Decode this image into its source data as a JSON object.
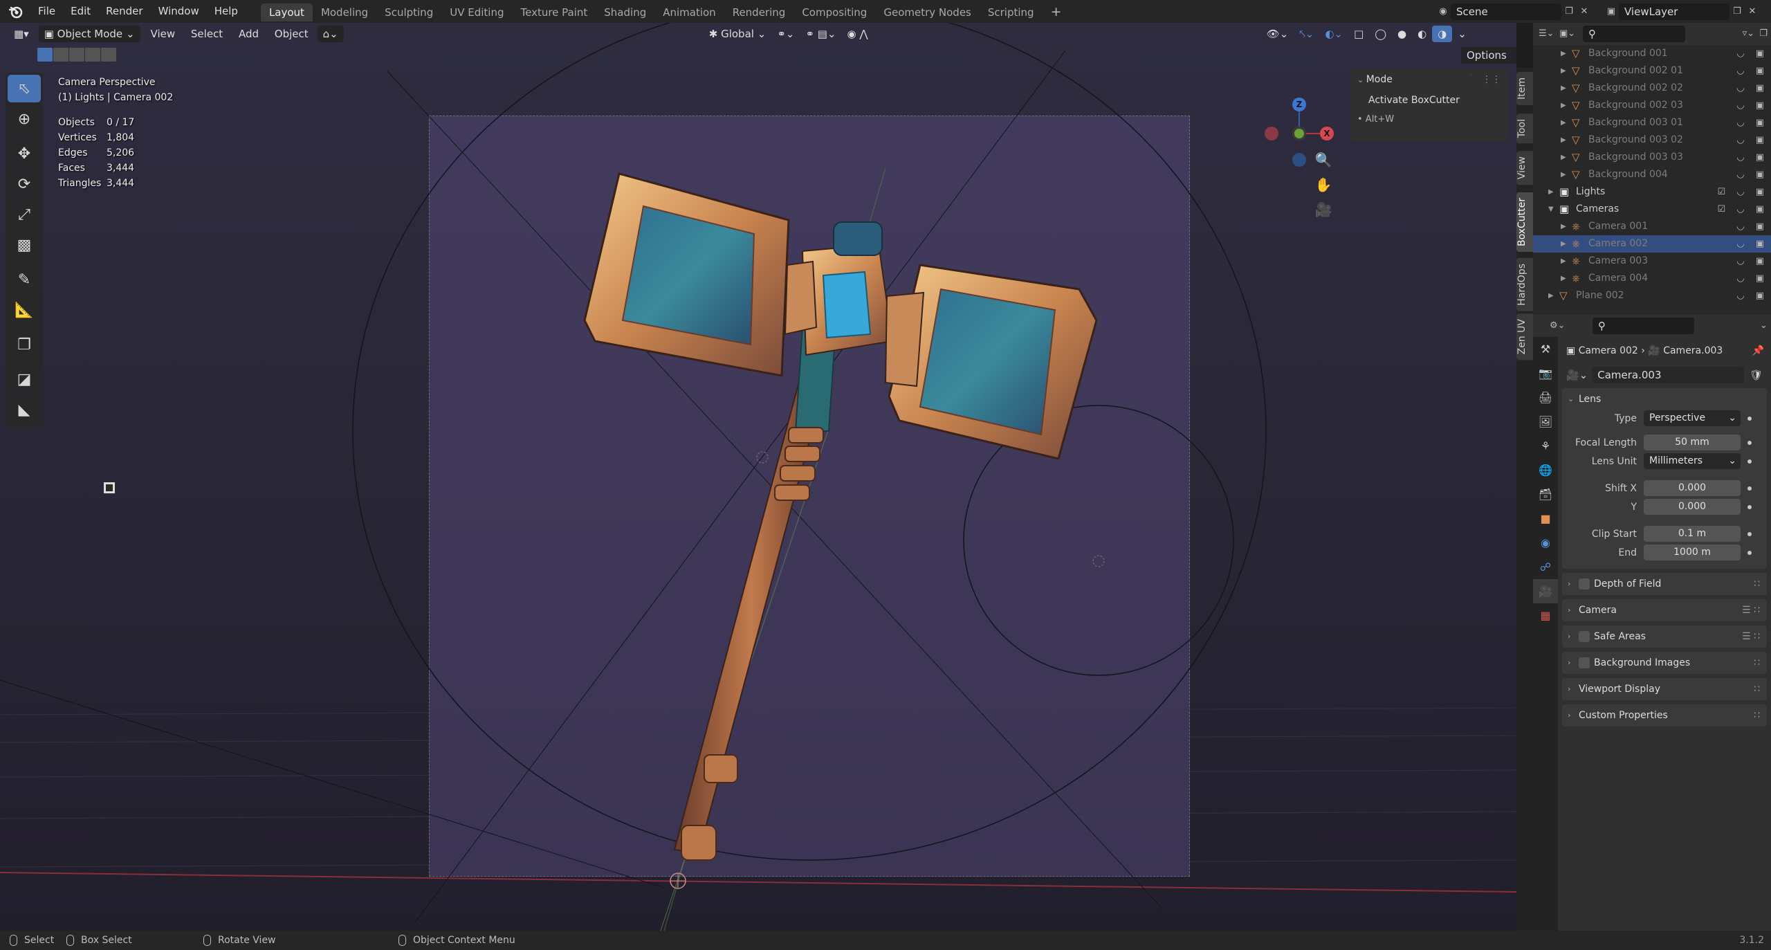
{
  "topbar": {
    "menu": [
      "File",
      "Edit",
      "Render",
      "Window",
      "Help"
    ],
    "workspaces": [
      "Layout",
      "Modeling",
      "Sculpting",
      "UV Editing",
      "Texture Paint",
      "Shading",
      "Animation",
      "Rendering",
      "Compositing",
      "Geometry Nodes",
      "Scripting"
    ],
    "active_workspace": "Layout",
    "add_tab": "+",
    "scene_name": "Scene",
    "view_layer_name": "ViewLayer"
  },
  "viewport_header": {
    "mode": "Object Mode",
    "menus": [
      "View",
      "Select",
      "Add",
      "Object"
    ],
    "transform_orientation": "Global",
    "options_label": "Options"
  },
  "viewport_overlay": {
    "view_name": "Camera Perspective",
    "collection_object": "(1) Lights | Camera 002",
    "stats": [
      {
        "label": "Objects",
        "value": "0 / 17"
      },
      {
        "label": "Vertices",
        "value": "1,804"
      },
      {
        "label": "Edges",
        "value": "5,206"
      },
      {
        "label": "Faces",
        "value": "3,444"
      },
      {
        "label": "Triangles",
        "value": "3,444"
      }
    ]
  },
  "mode_panel": {
    "title": "Mode",
    "button": "Activate BoxCutter",
    "hint": "• Alt+W"
  },
  "gizmo": {
    "x": "X",
    "y": "Y",
    "z": "Z"
  },
  "side_tabs": [
    "Item",
    "Tool",
    "View",
    "BoxCutter",
    "HardOps",
    "Zen UV"
  ],
  "outliner": {
    "rows": [
      {
        "name": "Background 001",
        "indent": 2,
        "type": "mesh",
        "dim": true
      },
      {
        "name": "Background 002 01",
        "indent": 2,
        "type": "mesh",
        "dim": true
      },
      {
        "name": "Background 002 02",
        "indent": 2,
        "type": "mesh",
        "dim": true
      },
      {
        "name": "Background 002 03",
        "indent": 2,
        "type": "mesh",
        "dim": true
      },
      {
        "name": "Background 003 01",
        "indent": 2,
        "type": "mesh",
        "dim": true
      },
      {
        "name": "Background 003 02",
        "indent": 2,
        "type": "mesh",
        "dim": true
      },
      {
        "name": "Background 003 03",
        "indent": 2,
        "type": "mesh",
        "dim": true
      },
      {
        "name": "Background 004",
        "indent": 2,
        "type": "mesh",
        "dim": true
      },
      {
        "name": "Lights",
        "indent": 1,
        "type": "collection",
        "dim": false
      },
      {
        "name": "Cameras",
        "indent": 1,
        "type": "collection",
        "dim": false
      },
      {
        "name": "Camera 001",
        "indent": 2,
        "type": "camera",
        "dim": true
      },
      {
        "name": "Camera 002",
        "indent": 2,
        "type": "camera",
        "dim": true,
        "selected": true
      },
      {
        "name": "Camera 003",
        "indent": 2,
        "type": "camera",
        "dim": true
      },
      {
        "name": "Camera 004",
        "indent": 2,
        "type": "camera",
        "dim": true
      },
      {
        "name": "Plane 002",
        "indent": 1,
        "type": "mesh",
        "dim": true
      }
    ]
  },
  "properties": {
    "breadcrumb_object": "Camera 002",
    "breadcrumb_data": "Camera.003",
    "datablock_name": "Camera.003",
    "lens_panel": {
      "title": "Lens",
      "type_label": "Type",
      "type_value": "Perspective",
      "focal_label": "Focal Length",
      "focal_value": "50 mm",
      "lens_unit_label": "Lens Unit",
      "lens_unit_value": "Millimeters",
      "shiftx_label": "Shift X",
      "shiftx_value": "0.000",
      "shifty_label": "Y",
      "shifty_value": "0.000",
      "clipstart_label": "Clip Start",
      "clipstart_value": "0.1 m",
      "clipend_label": "End",
      "clipend_value": "1000 m"
    },
    "collapsed_panels": [
      {
        "title": "Depth of Field",
        "checkbox": true,
        "list": false
      },
      {
        "title": "Camera",
        "checkbox": false,
        "list": true
      },
      {
        "title": "Safe Areas",
        "checkbox": true,
        "list": true
      },
      {
        "title": "Background Images",
        "checkbox": true,
        "list": false
      },
      {
        "title": "Viewport Display",
        "checkbox": false,
        "list": false
      },
      {
        "title": "Custom Properties",
        "checkbox": false,
        "list": false
      }
    ]
  },
  "statusbar": {
    "select": "Select",
    "box_select": "Box Select",
    "rotate_view": "Rotate View",
    "context_menu": "Object Context Menu",
    "version": "3.1.2"
  }
}
